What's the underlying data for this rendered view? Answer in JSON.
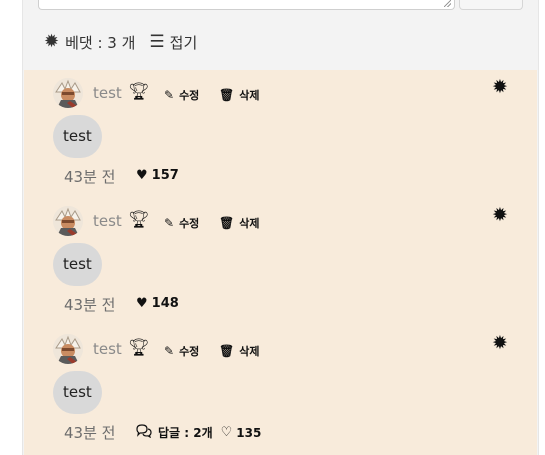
{
  "comment_bar": {
    "count_label": "베댓 : 3 개",
    "collapse_label": "접기"
  },
  "comments": [
    {
      "author": "test",
      "edit_label": "수정",
      "delete_label": "삭제",
      "text": "test",
      "time": "43분 전",
      "likes": "157"
    },
    {
      "author": "test",
      "edit_label": "수정",
      "delete_label": "삭제",
      "text": "test",
      "time": "43분 전",
      "likes": "148"
    },
    {
      "author": "test",
      "edit_label": "수정",
      "delete_label": "삭제",
      "text": "test",
      "time": "43분 전",
      "replies_label": "답글 : 2개",
      "likes": "135"
    }
  ]
}
